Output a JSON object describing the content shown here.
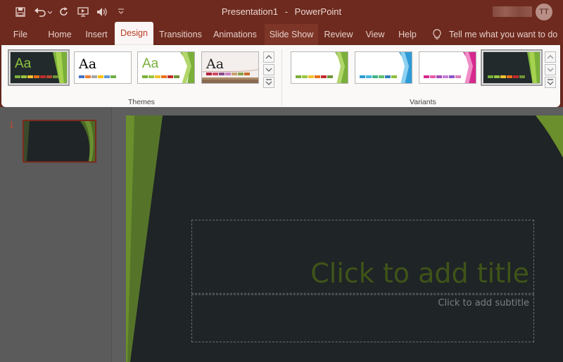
{
  "app": {
    "document_title": "Presentation1",
    "separator": "-",
    "app_name": "PowerPoint",
    "user_initials": "TT"
  },
  "quick_access": {
    "save": "save-icon",
    "undo": "undo-icon",
    "redo": "redo-icon",
    "present": "present-from-start-icon",
    "audio": "speaker-icon",
    "customize": "customize-toolbar-icon"
  },
  "tabs": [
    {
      "label": "File"
    },
    {
      "label": "Home"
    },
    {
      "label": "Insert"
    },
    {
      "label": "Design"
    },
    {
      "label": "Transitions"
    },
    {
      "label": "Animations"
    },
    {
      "label": "Slide Show"
    },
    {
      "label": "Review"
    },
    {
      "label": "View"
    },
    {
      "label": "Help"
    }
  ],
  "tell_me": {
    "label": "Tell me what you want to do"
  },
  "ribbon": {
    "themes_label": "Themes",
    "variants_label": "Variants",
    "themes": [
      {
        "sample": "Aa",
        "selected": true
      },
      {
        "sample": "Aa",
        "selected": false
      },
      {
        "sample": "Aa",
        "selected": false
      },
      {
        "sample": "Aa",
        "selected": false
      }
    ],
    "variant_count": 4
  },
  "slides_pane": {
    "slide_number": "1"
  },
  "slide": {
    "title_placeholder": "Click to add title",
    "subtitle_placeholder": "Click to add subtitle"
  },
  "colors": {
    "title_bar": "#6e2a1e",
    "active_tab_text": "#b83b22",
    "theme_green": "#7ab03a",
    "slide_background": "#1f2426"
  }
}
